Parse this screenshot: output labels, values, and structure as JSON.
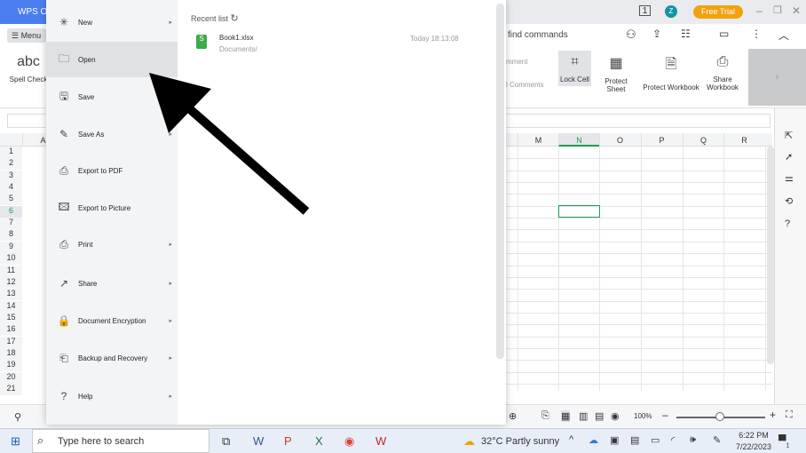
{
  "app": {
    "tab": "WPS Off",
    "menu": "Menu",
    "free_trial": "Free Trial",
    "avatar": "Z",
    "search": "find commands"
  },
  "ribbon": {
    "spell_check": "Spell Check",
    "comment": "mment",
    "comments": "l Comments",
    "lock_cell": "Lock Cell",
    "protect_sheet": "Protect Sheet",
    "protect_workbook": "Protect Workbook",
    "share_workbook": "Share Workbook",
    "more": "›"
  },
  "menu": {
    "items": [
      {
        "label": "New",
        "icon": "new-file-icon",
        "chev": true
      },
      {
        "label": "Open",
        "icon": "folder-icon",
        "chev": false
      },
      {
        "label": "Save",
        "icon": "save-icon",
        "chev": false
      },
      {
        "label": "Save As",
        "icon": "save-as-icon",
        "chev": true
      },
      {
        "label": "Export to PDF",
        "icon": "pdf-icon",
        "chev": false
      },
      {
        "label": "Export to Picture",
        "icon": "picture-icon",
        "chev": false
      },
      {
        "label": "Print",
        "icon": "print-icon",
        "chev": true
      },
      {
        "label": "Share",
        "icon": "share-icon",
        "chev": true
      },
      {
        "label": "Document Encryption",
        "icon": "lock-icon",
        "chev": true
      },
      {
        "label": "Backup and Recovery",
        "icon": "backup-icon",
        "chev": true
      },
      {
        "label": "Help",
        "icon": "help-icon",
        "chev": true
      }
    ]
  },
  "recent": {
    "title": "Recent list",
    "files": [
      {
        "name": "Book1.xlsx",
        "path": "Documents/",
        "time": "Today 18:13:08"
      }
    ]
  },
  "sheet": {
    "columns_left": [
      "A"
    ],
    "columns": [
      "M",
      "N",
      "O",
      "P",
      "Q",
      "R"
    ],
    "rows": [
      "1",
      "2",
      "3",
      "4",
      "5",
      "6",
      "7",
      "8",
      "9",
      "10",
      "11",
      "12",
      "13",
      "14",
      "15",
      "16",
      "17",
      "18",
      "19",
      "20",
      "21"
    ],
    "selected_cell": "N6"
  },
  "status": {
    "zoom": "100%"
  },
  "taskbar": {
    "search": "Type here to search",
    "weather": "32°C  Partly sunny",
    "time": "6:22 PM",
    "date": "7/22/2023",
    "notifications": "1"
  }
}
